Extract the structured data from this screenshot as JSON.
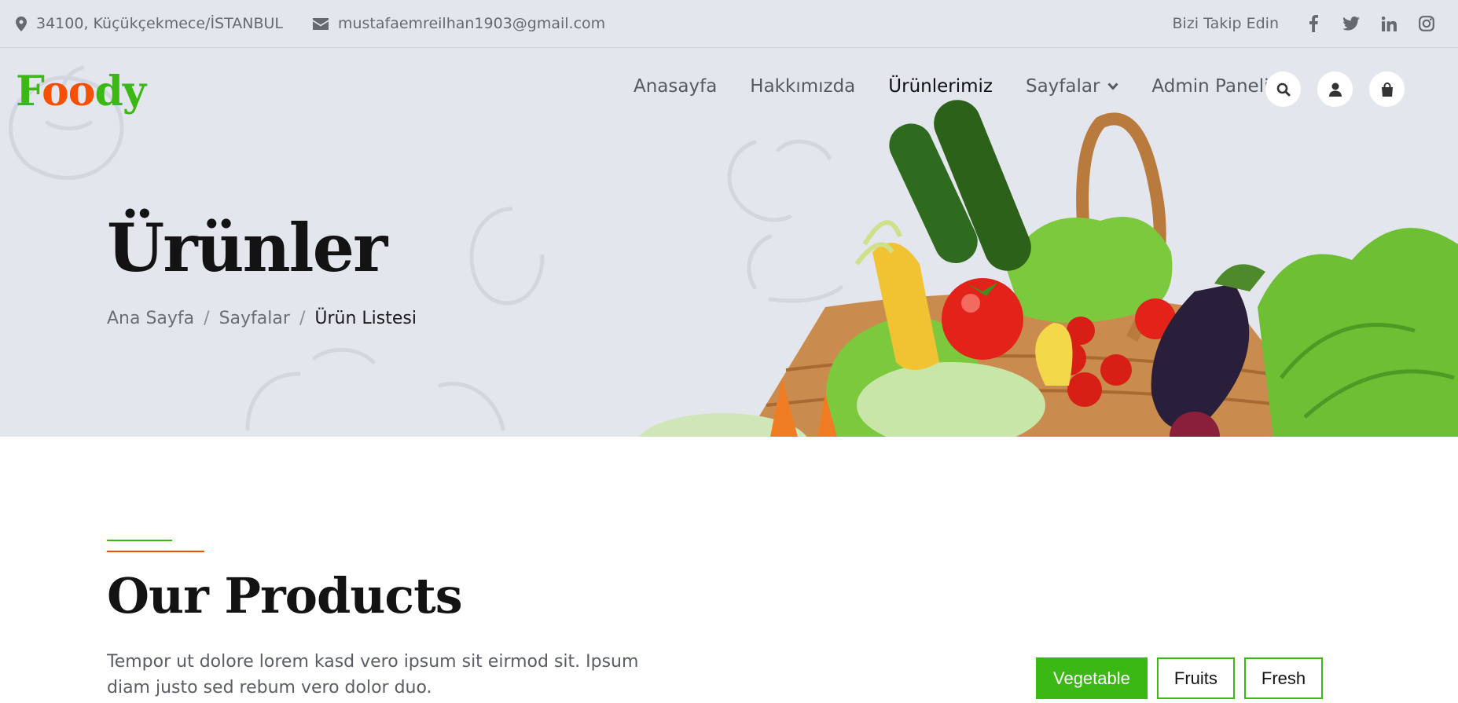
{
  "topbar": {
    "address": "34100, Küçükçekmece/İSTANBUL",
    "email": "mustafaemreilhan1903@gmail.com",
    "follow_label": "Bizi Takip Edin",
    "social_icons": [
      "facebook-icon",
      "twitter-icon",
      "linkedin-icon",
      "instagram-icon"
    ]
  },
  "logo": {
    "part1": "F",
    "part2": "oo",
    "part3": "dy"
  },
  "nav": {
    "items": [
      "Anasayfa",
      "Hakkımızda",
      "Ürünlerimiz",
      "Sayfalar",
      "Admin Paneli"
    ],
    "active": "Ürünlerimiz"
  },
  "header_icons": [
    "search-icon",
    "user-icon",
    "shopping-bag-icon"
  ],
  "hero": {
    "title": "Ürünler",
    "breadcrumb": [
      "Ana Sayfa",
      "Sayfalar",
      "Ürün Listesi"
    ]
  },
  "section": {
    "title": "Our Products",
    "description": "Tempor ut dolore lorem kasd vero ipsum sit eirmod sit. Ipsum diam justo sed rebum vero dolor duo.",
    "filters": [
      "Vegetable",
      "Fruits",
      "Fresh"
    ],
    "active_filter": "Vegetable"
  },
  "colors": {
    "primary": "#3cb815",
    "secondary": "#f65005",
    "hero_bg": "#e4e6ed",
    "dark": "#131313"
  }
}
